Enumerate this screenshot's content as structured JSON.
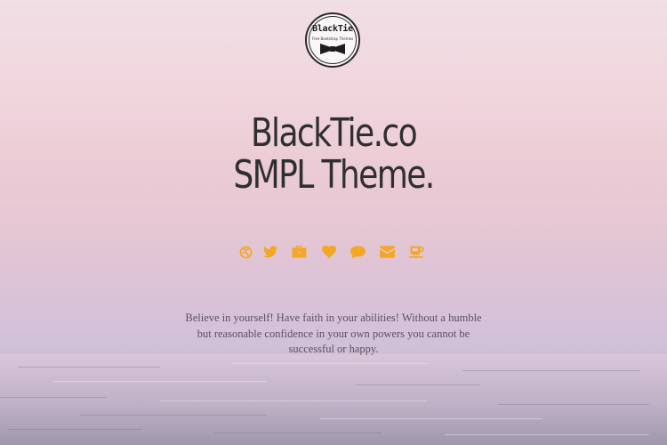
{
  "logo": {
    "brand": "BlackTie",
    "tagline": "Free Bootstrap Themes"
  },
  "hero": {
    "line1": "BlackTie.co",
    "line2": "SMPL Theme."
  },
  "social": {
    "accent_color": "#f5a623",
    "items": [
      {
        "icon": "dribbble-icon"
      },
      {
        "icon": "twitter-icon"
      },
      {
        "icon": "briefcase-icon"
      },
      {
        "icon": "heart-icon"
      },
      {
        "icon": "comment-icon"
      },
      {
        "icon": "envelope-icon"
      },
      {
        "icon": "coffee-icon"
      }
    ]
  },
  "quote": {
    "text": "Believe in yourself! Have faith in your abilities! Without a humble but reasonable confidence in your own powers you cannot be successful or happy."
  }
}
